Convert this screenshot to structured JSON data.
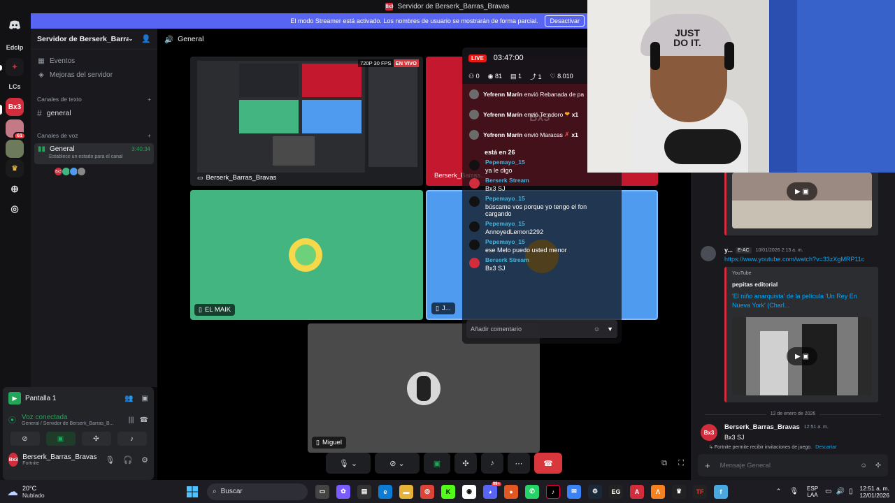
{
  "window": {
    "title": "Servidor de Berserk_Barras_Bravas",
    "server_icon_text": "Bx3"
  },
  "banner": {
    "text": "El modo Streamer está activado. Los nombres de usuario se mostrarán de forma parcial.",
    "button": "Desactivar"
  },
  "rail": {
    "items": [
      {
        "label": "Edclp"
      },
      {
        "label": "LCs"
      },
      {
        "label": "Bx3"
      }
    ],
    "badge": "61"
  },
  "sidebar": {
    "server_name": "Servidor de Berserk_Barras...",
    "links": [
      {
        "label": "Eventos"
      },
      {
        "label": "Mejoras del servidor"
      }
    ],
    "text_category": "Canales de texto",
    "text_channel": "general",
    "voice_category": "Canales de voz",
    "voice_channel": {
      "name": "General",
      "time": "3:40:34",
      "status": "Establece un estado para el canal"
    }
  },
  "user_panel": {
    "screen_label": "Pantalla 1",
    "voice_status": "Voz conectada",
    "voice_location": "General / Servidor de Berserk_Barras_B...",
    "username": "Berserk_Barras_Bravas",
    "activity": "Fortnite",
    "avatar_text": "Bx3"
  },
  "stage": {
    "channel": "General",
    "screen_tile": {
      "label": "Berserk_Barras_Bravas",
      "quality": "720P 30 FPS",
      "live": "EN VIVO"
    },
    "tiles": [
      {
        "label": "Berserk_Barras..."
      },
      {
        "label": "EL MAIK"
      },
      {
        "label": "J..."
      },
      {
        "label": "Miguel"
      }
    ]
  },
  "live": {
    "badge": "LIVE",
    "time": "03:47:00",
    "stats": [
      "0",
      "81",
      "1",
      "1",
      "8.010"
    ],
    "gifts": [
      {
        "name": "Yefrenn Marín",
        "text": "envió Rebanada de pa"
      },
      {
        "name": "Yefrenn Marín",
        "text": "envió Te adoro",
        "count": "x1"
      },
      {
        "name": "Yefrenn Marín",
        "text": "envió Maracas",
        "count": "x1"
      }
    ],
    "watermark": "Bx3",
    "partial_line": "está en 26",
    "comments": [
      {
        "user": "Pepemayo_15",
        "text": "ya le digo"
      },
      {
        "user": "Berserk Stream",
        "text": "Bx3 SJ"
      },
      {
        "user": "Pepemayo_15",
        "text": "búscame vos porque yo tengo el fon cargando"
      },
      {
        "user": "Pepemayo_15",
        "text": "AnnoyedLemon2292"
      },
      {
        "user": "Pepemayo_15",
        "text": "ese Melo puedo usted menor"
      },
      {
        "user": "Berserk Stream",
        "text": "Bx3 SJ"
      }
    ],
    "input_placeholder": "Añadir comentario"
  },
  "chat": {
    "msg1": {
      "user": "y...",
      "tag": "E-AC",
      "time": "10/01/2026 2:13 a. m.",
      "link": "https://www.youtube.com/watch?v=33zXgMRP11c"
    },
    "embed": {
      "provider": "YouTube",
      "author": "pepitas editorial",
      "title": "'El niño anarquista' de la película 'Un Rey En Nueva York' (Charl..."
    },
    "date_divider": "12 de enero de 2026",
    "msg2": {
      "user": "Berserk_Barras_Bravas",
      "time": "12:51 a. m.",
      "text": "Bx3 SJ",
      "avatar_text": "Bx3"
    },
    "system": {
      "text": "Fortnite permite recibir invitaciones de juego.",
      "action": "Descartar"
    },
    "input_placeholder": "Mensaje General"
  },
  "webcam": {
    "cap_text": "JUST DO IT."
  },
  "taskbar": {
    "weather_temp": "20°C",
    "weather_desc": "Nublado",
    "search_placeholder": "Buscar",
    "lang": "ESP",
    "region": "LAA",
    "time": "12:51 a. m.",
    "date": "12/01/2026",
    "discord_badge": "99+"
  },
  "colors": {
    "accent": "#5865f2",
    "brand": "#d12d3c",
    "voice_green": "#23a55a",
    "tile_green": "#43b581",
    "tile_blue": "#4f9bef",
    "live_red": "#e91916"
  }
}
